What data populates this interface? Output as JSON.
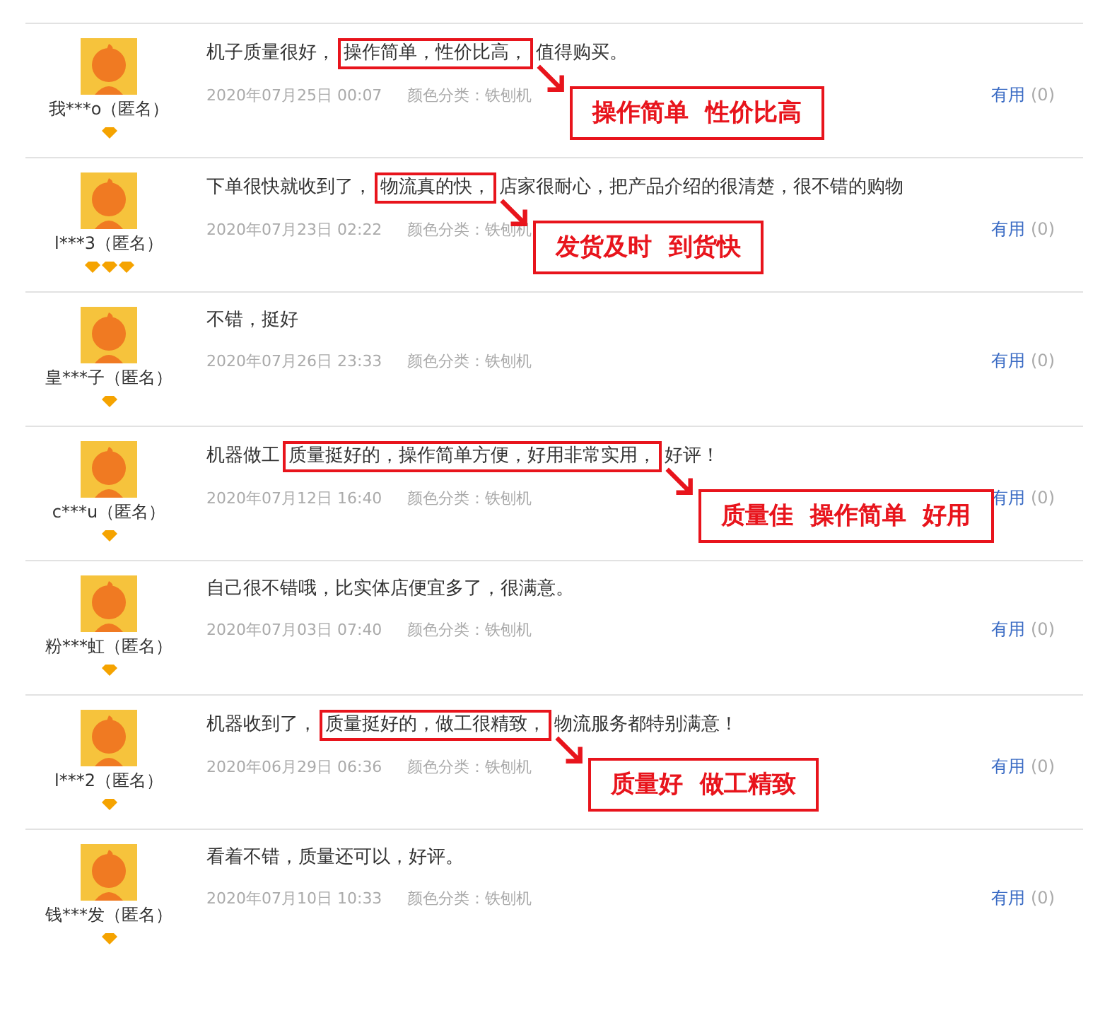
{
  "reviews": [
    {
      "user": "我***o（匿名）",
      "badges": [
        {
          "kind": "diamond"
        }
      ],
      "before": "机子质量很好，",
      "highlight": "操作简单，性价比高，",
      "after": "值得购买。",
      "date": "2020年07月25日 00:07",
      "category": "颜色分类：铁刨机",
      "useful": "有用",
      "useful_count": "(0)",
      "callout": "操作简单  性价比高"
    },
    {
      "user": "l***3（匿名）",
      "badges": [
        {
          "kind": "diamond"
        },
        {
          "kind": "diamond"
        },
        {
          "kind": "diamond"
        }
      ],
      "before": "下单很快就收到了，",
      "highlight": "物流真的快，",
      "after": "店家很耐心，把产品介绍的很清楚，很不错的购物",
      "date": "2020年07月23日 02:22",
      "category": "颜色分类：铁刨机",
      "useful": "有用",
      "useful_count": "(0)",
      "callout": "发货及时  到货快"
    },
    {
      "user": "皇***子（匿名）",
      "badges": [
        {
          "kind": "diamond"
        }
      ],
      "before": "不错，挺好",
      "date": "2020年07月26日 23:33",
      "category": "颜色分类：铁刨机",
      "useful": "有用",
      "useful_count": "(0)"
    },
    {
      "user": "c***u（匿名）",
      "badges": [
        {
          "kind": "diamond"
        }
      ],
      "before": "机器做工",
      "highlight": "质量挺好的，操作简单方便，好用非常实用，",
      "after": "好评！",
      "date": "2020年07月12日 16:40",
      "category": "颜色分类：铁刨机",
      "useful": "有用",
      "useful_count": "(0)",
      "callout": "质量佳  操作简单  好用"
    },
    {
      "user": "粉***虹（匿名）",
      "badges": [
        {
          "kind": "diamond"
        }
      ],
      "before": "自己很不错哦，比实体店便宜多了，很满意。",
      "date": "2020年07月03日 07:40",
      "category": "颜色分类：铁刨机",
      "useful": "有用",
      "useful_count": "(0)"
    },
    {
      "user": "l***2（匿名）",
      "badges": [
        {
          "kind": "diamond"
        }
      ],
      "before": "机器收到了，",
      "highlight": "质量挺好的，做工很精致，",
      "after": "物流服务都特别满意！",
      "date": "2020年06月29日 06:36",
      "category": "颜色分类：铁刨机",
      "useful": "有用",
      "useful_count": "(0)",
      "callout": "质量好  做工精致"
    },
    {
      "user": "钱***发（匿名）",
      "badges": [
        {
          "kind": "diamond"
        }
      ],
      "before": "看着不错，质量还可以，好评。",
      "date": "2020年07月10日 10:33",
      "category": "颜色分类：铁刨机",
      "useful": "有用",
      "useful_count": "(0)"
    }
  ]
}
